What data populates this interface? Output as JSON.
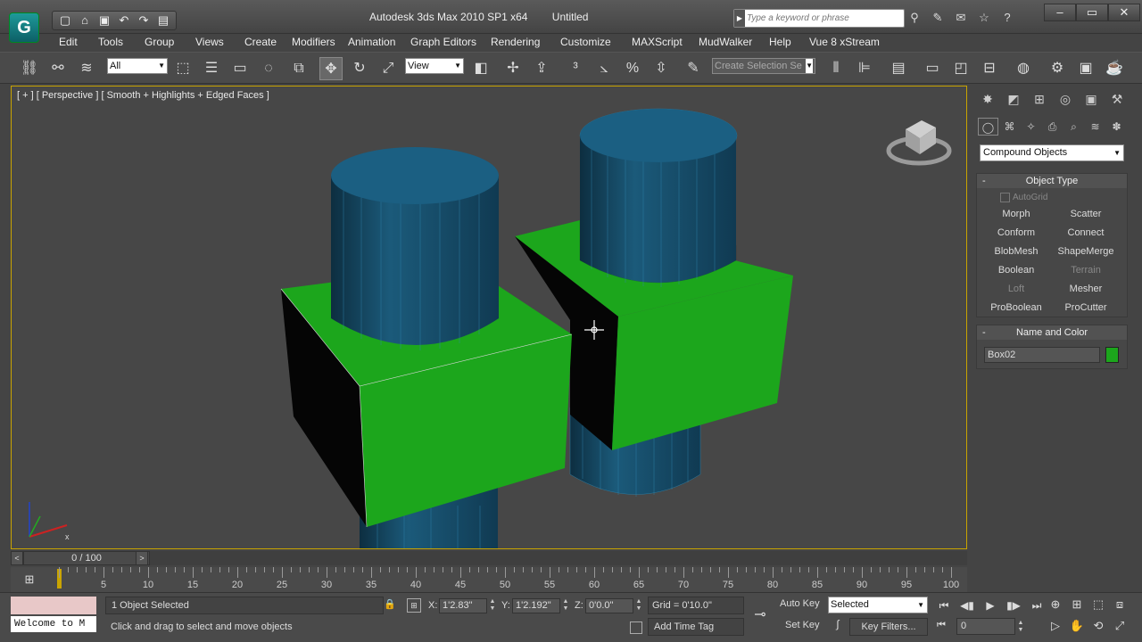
{
  "app": {
    "title": "Autodesk 3ds Max  2010 SP1 x64",
    "document": "Untitled",
    "logo_icon": "3ds-max-logo-icon"
  },
  "quick_access": [
    "new-icon",
    "open-icon",
    "save-icon",
    "undo-icon",
    "redo-icon",
    "project-icon"
  ],
  "search": {
    "placeholder": "Type a keyword or phrase"
  },
  "menu": [
    "Edit",
    "Tools",
    "Group",
    "Views",
    "Create",
    "Modifiers",
    "Animation",
    "Graph Editors",
    "Rendering",
    "Customize",
    "MAXScript",
    "MudWalker",
    "Help",
    "Vue 8 xStream"
  ],
  "toolbar": {
    "selection_filter": "All",
    "reference_coord": "View",
    "named_selection_placeholder": "Create Selection Se"
  },
  "viewport": {
    "label": "[ + ] [ Perspective ] [ Smooth + Highlights + Edged Faces ]",
    "axis_x": "x"
  },
  "command_panel": {
    "category": "Compound Objects",
    "object_type": {
      "title": "Object Type",
      "autogrid": "AutoGrid",
      "buttons": [
        {
          "label": "Morph",
          "enabled": true
        },
        {
          "label": "Scatter",
          "enabled": true
        },
        {
          "label": "Conform",
          "enabled": true
        },
        {
          "label": "Connect",
          "enabled": true
        },
        {
          "label": "BlobMesh",
          "enabled": true
        },
        {
          "label": "ShapeMerge",
          "enabled": true
        },
        {
          "label": "Boolean",
          "enabled": true
        },
        {
          "label": "Terrain",
          "enabled": false
        },
        {
          "label": "Loft",
          "enabled": false
        },
        {
          "label": "Mesher",
          "enabled": true
        },
        {
          "label": "ProBoolean",
          "enabled": true
        },
        {
          "label": "ProCutter",
          "enabled": true
        }
      ]
    },
    "name_and_color": {
      "title": "Name and Color",
      "name": "Box02",
      "color": "#1ca61c"
    }
  },
  "time_slider": {
    "frame": "0 / 100",
    "ticks": [
      "5",
      "10",
      "15",
      "20",
      "25",
      "30",
      "35",
      "40",
      "45",
      "50",
      "55",
      "60",
      "65",
      "70",
      "75",
      "80",
      "85",
      "90",
      "95",
      "100"
    ]
  },
  "status": {
    "maxscript_text": "Welcome to M",
    "selection": "1 Object Selected",
    "prompt": "Click and drag to select and move objects",
    "x_label": "X:",
    "x_value": "1'2.83\"",
    "y_label": "Y:",
    "y_value": "1'2.192\"",
    "z_label": "Z:",
    "z_value": "0'0.0\"",
    "grid": "Grid = 0'10.0\"",
    "add_time_tag": "Add Time Tag",
    "auto_key": "Auto Key",
    "set_key": "Set Key",
    "key_mode": "Selected",
    "key_filters": "Key Filters...",
    "current_frame": "0"
  },
  "colors": {
    "box_green": "#1ca61c",
    "cylinder_blue": "#1a5a78",
    "selection_border": "#c9a400"
  }
}
